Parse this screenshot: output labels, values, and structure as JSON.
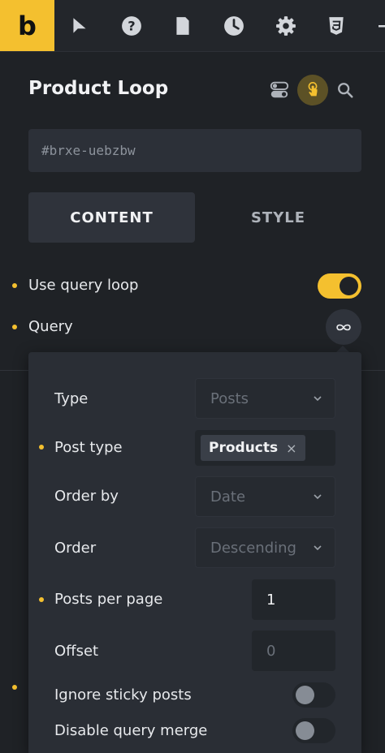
{
  "app": {
    "brand_letter": "b"
  },
  "toolbar": {
    "icons": [
      "cursor-icon",
      "help-icon",
      "page-icon",
      "history-icon",
      "settings-icon",
      "css3-icon"
    ]
  },
  "panel": {
    "title": "Product Loop",
    "element_id": "#brxe-uebzbw",
    "tabs": {
      "content": "CONTENT",
      "style": "STYLE"
    }
  },
  "controls": {
    "use_query_loop": {
      "label": "Use query loop",
      "enabled": true
    },
    "query": {
      "label": "Query"
    }
  },
  "query_popup": {
    "type": {
      "label": "Type",
      "value": "Posts"
    },
    "post_type": {
      "label": "Post type",
      "chip": "Products",
      "remove": "×"
    },
    "order_by": {
      "label": "Order by",
      "value": "Date"
    },
    "order": {
      "label": "Order",
      "value": "Descending"
    },
    "posts_per_page": {
      "label": "Posts per page",
      "value": "1"
    },
    "offset": {
      "label": "Offset",
      "placeholder": "0"
    },
    "ignore_sticky": {
      "label": "Ignore sticky posts",
      "enabled": false
    },
    "disable_merge": {
      "label": "Disable query merge",
      "enabled": false
    }
  },
  "colors": {
    "accent": "#f4c02f",
    "background": "#1f2226",
    "surface": "#2a2e35"
  }
}
